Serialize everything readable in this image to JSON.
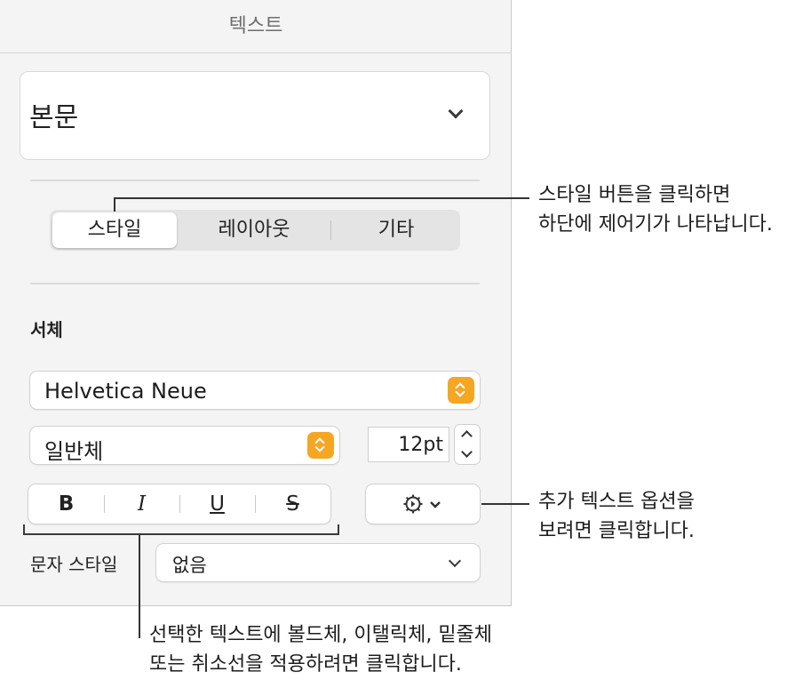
{
  "panel": {
    "title": "텍스트",
    "paragraph_style": "본문",
    "tabs": [
      {
        "label": "스타일",
        "active": true
      },
      {
        "label": "레이아웃",
        "active": false
      },
      {
        "label": "기타",
        "active": false
      }
    ],
    "font_section_label": "서체",
    "font_family": "Helvetica Neue",
    "font_typeface": "일반체",
    "font_size": "12pt",
    "format_buttons": {
      "bold": "B",
      "italic": "I",
      "underline": "U",
      "strikethrough": "S"
    },
    "character_style_label": "문자 스타일",
    "character_style_value": "없음",
    "accent_color": "#f5a623"
  },
  "callouts": {
    "tabs": [
      "스타일 버튼을 클릭하면",
      "하단에 제어기가 나타납니다."
    ],
    "more_options": [
      "추가 텍스트 옵션을",
      "보려면 클릭합니다."
    ],
    "format_buttons": [
      "선택한 텍스트에 볼드체, 이탤릭체, 밑줄체",
      "또는 취소선을 적용하려면 클릭합니다."
    ]
  }
}
